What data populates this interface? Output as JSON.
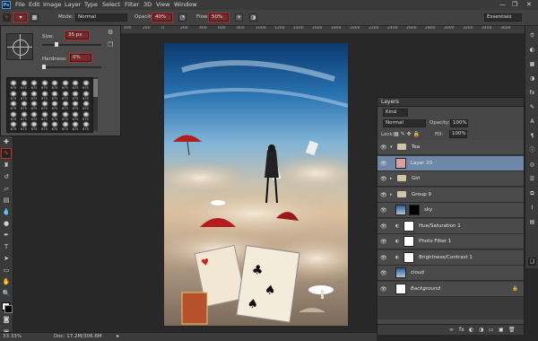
{
  "menubar": {
    "logo": "Ps",
    "items": [
      "File",
      "Edit",
      "Image",
      "Layer",
      "Type",
      "Select",
      "Filter",
      "3D",
      "View",
      "Window"
    ],
    "minimize": "—",
    "maximize": "❐",
    "close": "✕"
  },
  "options": {
    "mode_label": "Mode:",
    "mode_value": "Normal",
    "opacity_label": "Opacity:",
    "opacity_value": "40%",
    "flow_label": "Flow:",
    "flow_value": "50%",
    "workspace": "Essentials"
  },
  "ruler": {
    "ticks": [
      "1600",
      "1400",
      "1200",
      "1000",
      "800",
      "600",
      "400",
      "200",
      "0",
      "200",
      "400",
      "600",
      "800",
      "1000",
      "1200",
      "1400",
      "1600",
      "1800",
      "2000",
      "2200",
      "2400",
      "2600",
      "2800",
      "3000",
      "3200",
      "3400",
      "3600"
    ]
  },
  "brush": {
    "size_label": "Size:",
    "size_value": "35 px",
    "hardness_label": "Hardness:",
    "hardness_value": "0%",
    "size_level": 0.22,
    "hardness_level": 0.0,
    "presets": [
      "675",
      "675",
      "675",
      "675",
      "675",
      "675",
      "675",
      "675",
      "675",
      "675",
      "675",
      "675",
      "675",
      "675",
      "675",
      "675",
      "675",
      "675",
      "675",
      "675",
      "675",
      "675",
      "675",
      "675",
      "675",
      "675",
      "675",
      "675",
      "675",
      "675",
      "675",
      "675",
      "675",
      "675",
      "675",
      "675",
      "675",
      "675",
      "675",
      "675"
    ]
  },
  "layers": {
    "title": "Layers",
    "kind": "Kind",
    "blend": "Normal",
    "opacity_label": "Opacity:",
    "opacity_value": "100%",
    "lock_label": "Lock:",
    "fill_label": "Fill:",
    "fill_value": "100%",
    "rows": [
      {
        "name": "Tea",
        "type": "group-open"
      },
      {
        "name": "Layer 20",
        "type": "layer",
        "selected": true
      },
      {
        "name": "Girl",
        "type": "group"
      },
      {
        "name": "Group 9",
        "type": "group"
      },
      {
        "name": "sky",
        "type": "image"
      },
      {
        "name": "Hue/Saturation 1",
        "type": "adjust"
      },
      {
        "name": "Photo Filter 1",
        "type": "adjust"
      },
      {
        "name": "Brightness/Contrast 1",
        "type": "adjust"
      },
      {
        "name": "cloud",
        "type": "image"
      },
      {
        "name": "Background",
        "type": "background"
      }
    ],
    "footer": [
      "∞",
      "fx",
      "◐",
      "◑",
      "▭",
      "▣",
      "🗑"
    ]
  },
  "status": {
    "zoom": "33.33%",
    "doc": "Doc: 17.2M/306.6M"
  },
  "colors": {
    "accent": "#c62828",
    "selected": "#6d87a8"
  }
}
